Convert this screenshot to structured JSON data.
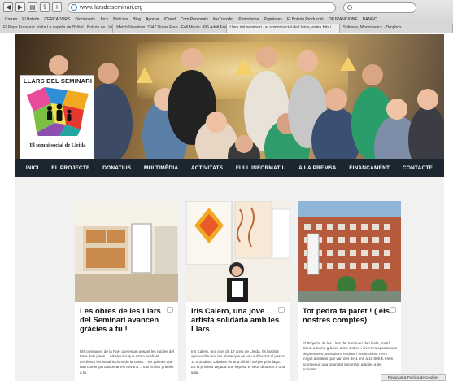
{
  "browser": {
    "url": "www.llarsdelseminari.org",
    "bookmarks": [
      "Correo",
      "El Bolsón",
      "CERCADORS",
      "Diccionaris",
      "Jocs",
      "Notícies",
      "Blog",
      "Aportar",
      "iCloud",
      "Com Personals",
      "MeTransfer",
      "Periodisme",
      "Populares",
      "El Bolsón Producció",
      "OBJRANCIONE",
      "BANGO"
    ],
    "tabs": [
      "El Papa Francesc visita La capella de l'Hôtel · Bolsón de Lleida",
      "Match Nosotros: 7947 Driver Free · Full Movie: 496 Adult Free…",
      "Llars del seminari · el somni social de Lleida, estes bés i…",
      "Sofware, Monomerics · Dropbox"
    ]
  },
  "hero": {
    "logo_title": "LLARS DEL SEMINARI",
    "logo_subtitle": "El somni social de Lleida"
  },
  "nav": {
    "items": [
      "INICI",
      "EL PROJECTE",
      "DONATIUS",
      "MULTIMÈDIA",
      "ACTIVITATS",
      "FULL INFORMATIU",
      "A LA PREMSA",
      "FINANÇAMENT",
      "CONTACTE"
    ]
  },
  "posts": [
    {
      "title": "Les obres de les Llars del Seminari avancen gràcies a tu !",
      "text": "Els companys de la PaH que estan posant les rajoles del terra dels pisos… els tècnics que estan acabant d'enllestir les instal·lacions de la cuina… els paletes que han començat a aixecar els envans… tots ho fan gràcies a tu."
    },
    {
      "title": "Iris Calero, una jove artista solidària amb les Llars",
      "text": "Iris Calero, una jove de 17 anys de Lleida, és l'artista que va dibuixar les obres que es van subhastar el passat 11 d'octubre. Dibuixar és una afició i val per pols·laga. Es la primera vegada que exposa el seus dibuixos a una sala."
    },
    {
      "title": "Tot pedra fa paret ! ( els nostres comptes)",
      "text": "El Projecte de les Llars del Seminari de Lleida, s'està duent a terme gràcies a les moltes i diverses aportacions de persones particulars, entitats i institucions. Hem inngut donatius que van des de 1 fins a 10.000 €. Hem aconseguit una quantitat important gràcies a les activitats"
    }
  ],
  "cookie_notice": "Privacitat & Política de Cookies",
  "colors": {
    "navbar_bg": "#1b2631",
    "content_bg": "#f1f1f1"
  }
}
